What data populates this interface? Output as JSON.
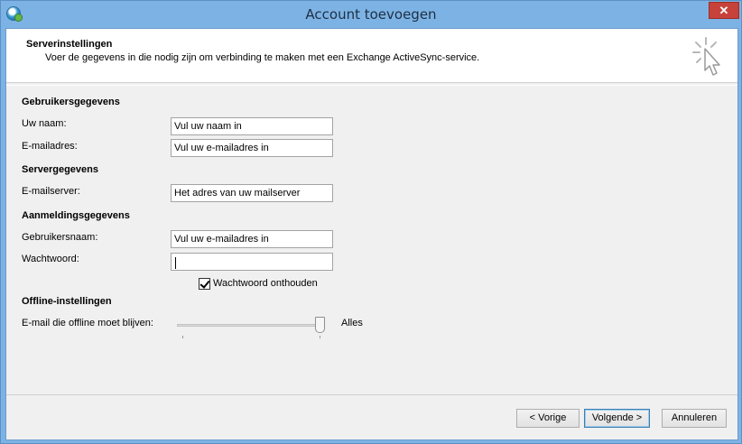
{
  "window": {
    "title": "Account toevoegen",
    "close_glyph": "✕"
  },
  "header": {
    "title": "Serverinstellingen",
    "subtitle": "Voer de gegevens in die nodig zijn om verbinding te maken met een Exchange ActiveSync-service."
  },
  "sections": {
    "user": "Gebruikersgegevens",
    "server": "Servergegevens",
    "login": "Aanmeldingsgegevens",
    "offline": "Offline-instellingen"
  },
  "fields": {
    "name": {
      "label": "Uw naam:",
      "value": "Vul uw naam in"
    },
    "email": {
      "label": "E-mailadres:",
      "value": "Vul uw e-mailadres in"
    },
    "mailserver": {
      "label": "E-mailserver:",
      "value": "Het adres van uw mailserver"
    },
    "username": {
      "label": "Gebruikersnaam:",
      "value": "Vul uw e-mailadres in"
    },
    "password": {
      "label": "Wachtwoord:",
      "value": ""
    }
  },
  "remember_password": {
    "label": "Wachtwoord onthouden",
    "checked": true
  },
  "offline": {
    "label": "E-mail die offline moet blijven:",
    "value": "Alles",
    "slider_level": 1.0
  },
  "buttons": {
    "back": "< Vorige",
    "next": "Volgende >",
    "cancel": "Annuleren"
  },
  "icons": {
    "app": "outlook-app-icon",
    "header": "cursor-sparkle-icon",
    "close": "close-icon"
  }
}
